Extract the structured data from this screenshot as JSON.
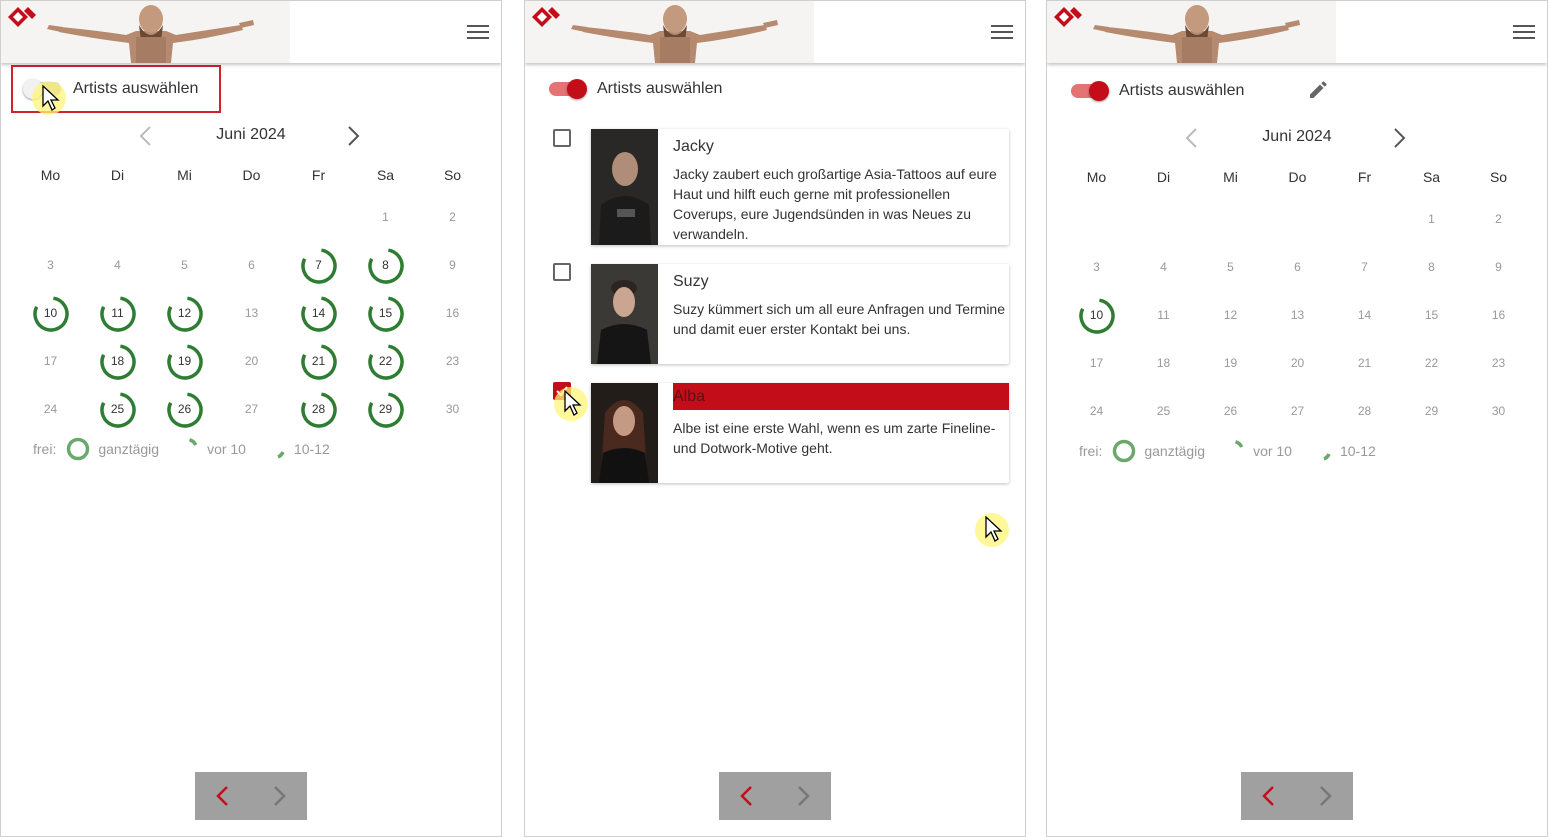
{
  "colors": {
    "accent": "#c30e1a",
    "available": "#2e7d32",
    "muted": "#999999"
  },
  "toggle_label": "Artists auswählen",
  "month_title": "Juni 2024",
  "weekdays": [
    "Mo",
    "Di",
    "Mi",
    "Do",
    "Fr",
    "Sa",
    "So"
  ],
  "legend": {
    "prefix": "frei:",
    "full_day": "ganztägig",
    "before_10": "vor 10",
    "range_10_12": "10-12"
  },
  "icons": {
    "menu": "menu-icon",
    "prev": "chevron-left-icon",
    "next": "chevron-right-icon",
    "edit": "pencil-icon",
    "logo": "logo-diamond-icon"
  },
  "panel1": {
    "toggle_on": false,
    "days": [
      "1",
      "2",
      "3",
      "4",
      "5",
      "6",
      "7",
      "8",
      "9",
      "10",
      "11",
      "12",
      "13",
      "14",
      "15",
      "16",
      "17",
      "18",
      "19",
      "20",
      "21",
      "22",
      "23",
      "24",
      "25",
      "26",
      "27",
      "28",
      "29",
      "30"
    ],
    "available_days": [
      7,
      8,
      10,
      11,
      12,
      14,
      15,
      18,
      19,
      21,
      22,
      25,
      26,
      28,
      29
    ]
  },
  "panel2": {
    "toggle_on": true,
    "artists": [
      {
        "name": "Jacky",
        "checked": false,
        "description": "Jacky zaubert euch großartige Asia-Tattoos auf eure Haut und hilft euch gerne mit professionellen Coverups, eure Jugendsünden in was Neues zu verwandeln."
      },
      {
        "name": "Suzy",
        "checked": false,
        "description": "Suzy kümmert sich um all eure Anfragen und Termine und damit euer erster Kontakt bei uns."
      },
      {
        "name": "Alba",
        "checked": true,
        "description": "Albe ist eine erste Wahl, wenn es um zarte Fineline- und Dotwork-Motive geht."
      }
    ]
  },
  "panel3": {
    "toggle_on": true,
    "days": [
      "1",
      "2",
      "3",
      "4",
      "5",
      "6",
      "7",
      "8",
      "9",
      "10",
      "11",
      "12",
      "13",
      "14",
      "15",
      "16",
      "17",
      "18",
      "19",
      "20",
      "21",
      "22",
      "23",
      "24",
      "25",
      "26",
      "27",
      "28",
      "29",
      "30"
    ],
    "available_days": [
      10
    ]
  }
}
